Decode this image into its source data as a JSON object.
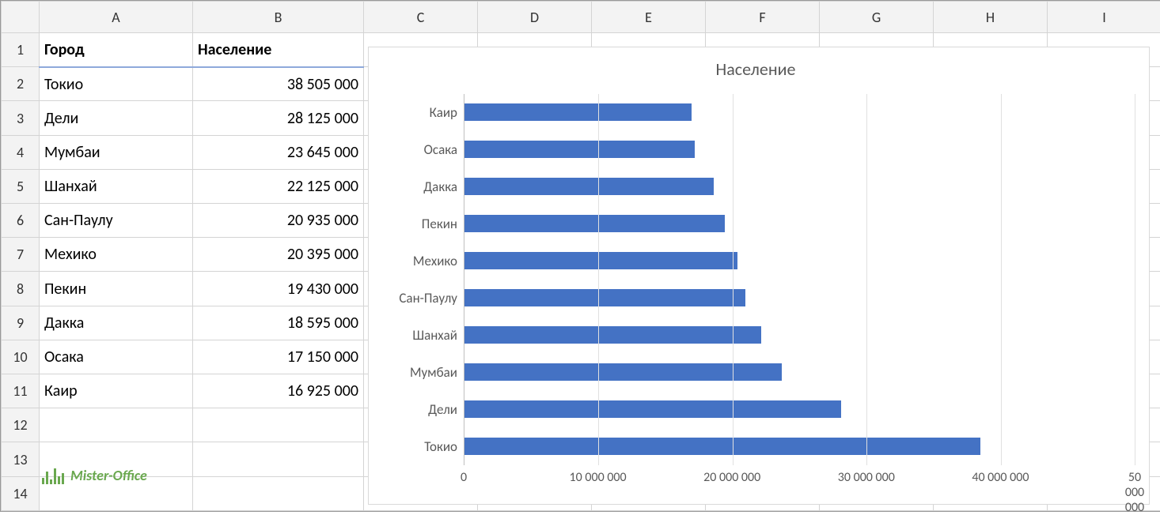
{
  "columns": [
    "A",
    "B",
    "C",
    "D",
    "E",
    "F",
    "G",
    "H",
    "I"
  ],
  "row_numbers": [
    1,
    2,
    3,
    4,
    5,
    6,
    7,
    8,
    9,
    10,
    11,
    12,
    13,
    14
  ],
  "headers": {
    "city": "Город",
    "population": "Население"
  },
  "table_rows": [
    {
      "city": "Токио",
      "pop": "38 505 000"
    },
    {
      "city": "Дели",
      "pop": "28 125 000"
    },
    {
      "city": "Мумбаи",
      "pop": "23 645 000"
    },
    {
      "city": "Шанхай",
      "pop": "22 125 000"
    },
    {
      "city": "Сан-Паулу",
      "pop": "20 935 000"
    },
    {
      "city": "Мехико",
      "pop": "20 395 000"
    },
    {
      "city": "Пекин",
      "pop": "19 430 000"
    },
    {
      "city": "Дакка",
      "pop": "18 595 000"
    },
    {
      "city": "Осака",
      "pop": "17 150 000"
    },
    {
      "city": "Каир",
      "pop": "16 925 000"
    }
  ],
  "watermark": "Mister-Office",
  "chart_data": {
    "type": "bar",
    "orientation": "horizontal",
    "title": "Население",
    "xlabel": "",
    "ylabel": "",
    "xlim": [
      0,
      50000000
    ],
    "x_ticks": [
      0,
      10000000,
      20000000,
      30000000,
      40000000,
      50000000
    ],
    "x_tick_labels": [
      "0",
      "10 000 000",
      "20 000 000",
      "30 000 000",
      "40 000 000",
      "50 000 000"
    ],
    "categories": [
      "Каир",
      "Осака",
      "Дакка",
      "Пекин",
      "Мехико",
      "Сан-Паулу",
      "Шанхай",
      "Мумбаи",
      "Дели",
      "Токио"
    ],
    "values": [
      16925000,
      17150000,
      18595000,
      19430000,
      20395000,
      20935000,
      22125000,
      23645000,
      28125000,
      38505000
    ],
    "bar_color": "#4472c4",
    "grid": true
  }
}
